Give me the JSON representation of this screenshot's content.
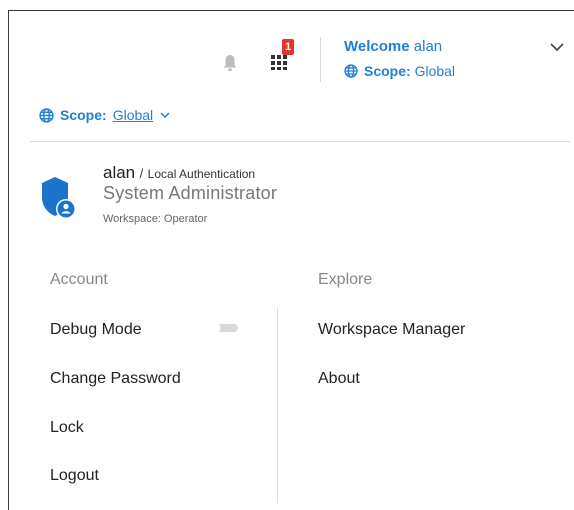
{
  "header": {
    "notification_badge": "1",
    "welcome_prefix": "Welcome",
    "welcome_user": "alan",
    "scope_label": "Scope:",
    "scope_value": "Global"
  },
  "panel": {
    "scope_label": "Scope:",
    "scope_value": "Global",
    "user": {
      "name": "alan",
      "separator": "/",
      "auth": "Local Authentication",
      "role": "System Administrator",
      "workspace": "Workspace: Operator"
    },
    "account": {
      "title": "Account",
      "debug_mode": "Debug Mode",
      "debug_mode_on": false,
      "change_password": "Change Password",
      "lock": "Lock",
      "logout": "Logout"
    },
    "explore": {
      "title": "Explore",
      "workspace_manager": "Workspace Manager",
      "about": "About"
    }
  },
  "icons": {
    "bell": "bell-icon",
    "apps": "apps-grid-icon",
    "globe": "globe-icon",
    "chevron": "chevron-down-icon",
    "shield": "shield-user-icon"
  },
  "colors": {
    "accent": "#1f7fd6",
    "badge": "#e5342c",
    "shield": "#1b74c9"
  }
}
